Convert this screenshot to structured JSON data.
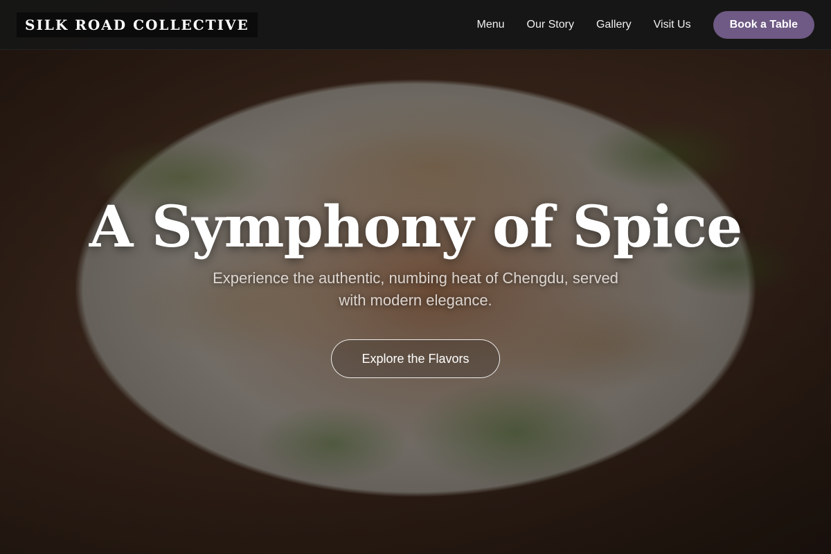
{
  "brand": {
    "name": "SILK ROAD COLLECTIVE"
  },
  "nav": {
    "links": [
      {
        "label": "Menu"
      },
      {
        "label": "Our Story"
      },
      {
        "label": "Gallery"
      },
      {
        "label": "Visit Us"
      }
    ],
    "cta_label": "Book a Table"
  },
  "hero": {
    "title": "A Symphony of Spice",
    "subtitle": "Experience the authentic, numbing heat of Chengdu, served with modern elegance.",
    "button_label": "Explore the Flavors",
    "image_subject": "stir-fried pork with green onions and chili"
  },
  "colors": {
    "navbar": "#161616",
    "accent": "#6e5a84",
    "text": "#ffffff"
  }
}
